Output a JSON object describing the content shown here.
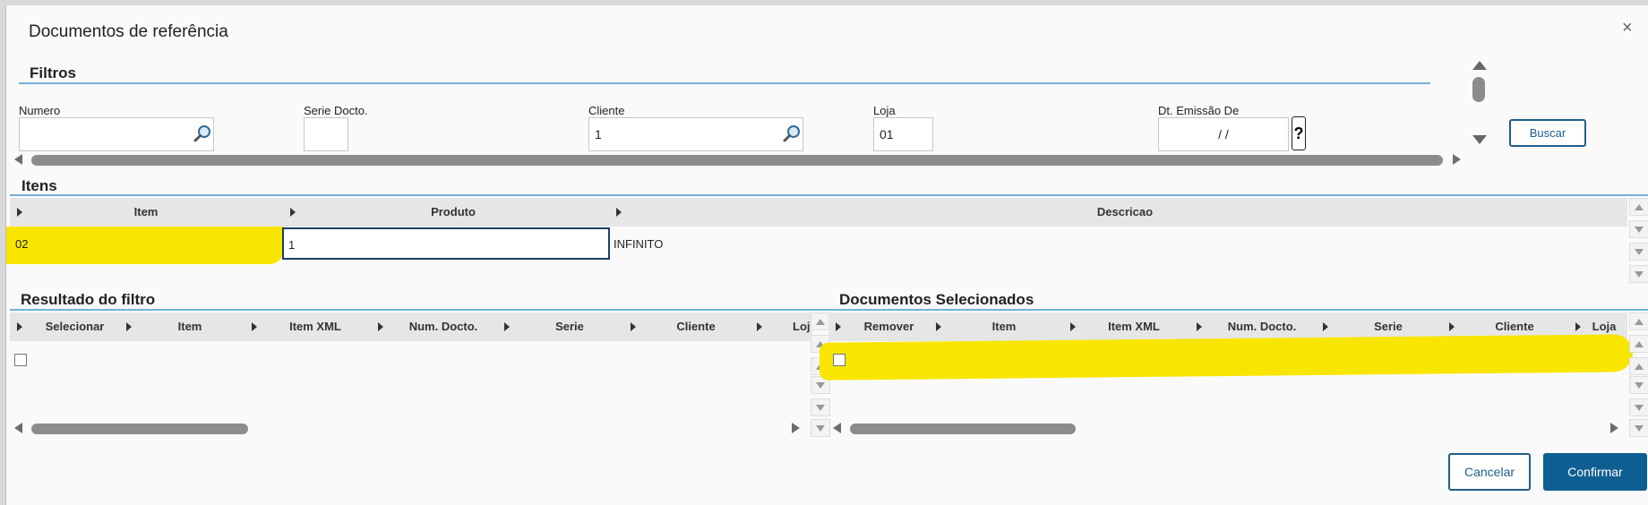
{
  "dialog": {
    "title": "Documentos de referência",
    "close_symbol": "×"
  },
  "filtros": {
    "title": "Filtros",
    "fields": {
      "numero": {
        "label": "Numero",
        "value": ""
      },
      "serie": {
        "label": "Serie Docto.",
        "value": ""
      },
      "cliente": {
        "label": "Cliente",
        "value": "1"
      },
      "loja": {
        "label": "Loja",
        "value": "01"
      },
      "dt_emissao": {
        "label": "Dt. Emissão De",
        "value": "/ /"
      }
    },
    "help_symbol": "?",
    "buscar_label": "Buscar"
  },
  "itens": {
    "title": "Itens",
    "columns": [
      "Item",
      "Produto",
      "Descricao"
    ],
    "rows": [
      {
        "item": "02",
        "produto": "1",
        "descricao": "INFINITO"
      }
    ]
  },
  "resultado": {
    "title": "Resultado do filtro",
    "columns": [
      "Selecionar",
      "Item",
      "Item XML",
      "Num. Docto.",
      "Serie",
      "Cliente",
      "Loj"
    ]
  },
  "selecionados": {
    "title": "Documentos Selecionados",
    "columns": [
      "Remover",
      "Item",
      "Item XML",
      "Num. Docto.",
      "Serie",
      "Cliente",
      "Loja"
    ]
  },
  "footer": {
    "cancelar_label": "Cancelar",
    "confirmar_label": "Confirmar"
  },
  "colors": {
    "accent": "#0f5e91",
    "section_line": "#6fb2dc",
    "highlight": "#f8e600"
  }
}
